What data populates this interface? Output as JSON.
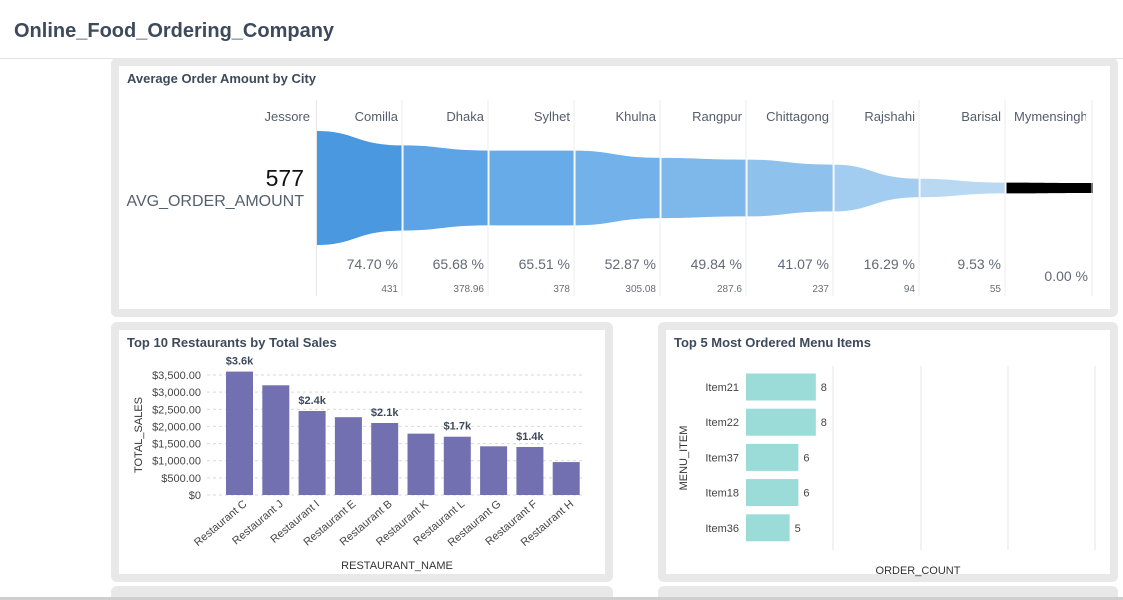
{
  "page": {
    "title": "Online_Food_Ordering_Company"
  },
  "funnel_tile": {
    "title": "Average Order Amount by City",
    "kpi_value": "577",
    "kpi_label": "AVG_ORDER_AMOUNT"
  },
  "bar_tile": {
    "title": "Top 10 Restaurants by Total Sales"
  },
  "hbar_tile": {
    "title": "Top 5 Most Ordered Menu Items"
  },
  "colors": {
    "funnel": [
      "#4a98e0",
      "#5da4e6",
      "#67abe8",
      "#72b1e9",
      "#7eb8eb",
      "#8fc1ed",
      "#a3cdf0",
      "#b9d9f3"
    ],
    "bar": "#7370b1",
    "hbar": "#9bdbd8"
  },
  "chart_data": [
    {
      "type": "funnel",
      "title": "Average Order Amount by City",
      "categories": [
        "Jessore",
        "Comilla",
        "Dhaka",
        "Sylhet",
        "Khulna",
        "Rangpur",
        "Chittagong",
        "Rajshahi",
        "Barisal",
        "Mymensingh"
      ],
      "category_labels": [
        "Jessore",
        "Comilla",
        "Dhaka",
        "Sylhet",
        "Khulna",
        "Rangpur",
        "Chittagong",
        "Rajshahi",
        "Barisal",
        "Mymensingh"
      ],
      "values": [
        577,
        431,
        378.96,
        378,
        305.08,
        287.6,
        237,
        94,
        55,
        0
      ],
      "percent_labels": [
        "74.70 %",
        "65.68 %",
        "65.51 %",
        "52.87 %",
        "49.84 %",
        "41.07 %",
        "16.29 %",
        "9.53 %",
        "0.00 %"
      ],
      "value_labels": [
        "431",
        "378.96",
        "378",
        "305.08",
        "287.6",
        "237",
        "94",
        "55"
      ]
    },
    {
      "type": "bar",
      "title": "Top 10 Restaurants by Total Sales",
      "xlabel": "RESTAURANT_NAME",
      "ylabel": "TOTAL_SALES",
      "categories": [
        "Restaurant C",
        "Restaurant J",
        "Restaurant I",
        "Restaurant E",
        "Restaurant B",
        "Restaurant K",
        "Restaurant L",
        "Restaurant G",
        "Restaurant F",
        "Restaurant H"
      ],
      "values": [
        3600,
        3200,
        2450,
        2270,
        2100,
        1790,
        1700,
        1420,
        1400,
        960
      ],
      "data_labels": [
        "$3.6k",
        "",
        "$2.4k",
        "",
        "$2.1k",
        "",
        "$1.7k",
        "",
        "$1.4k",
        ""
      ],
      "ylim": [
        0,
        3500
      ],
      "yticks": [
        0,
        500,
        1000,
        1500,
        2000,
        2500,
        3000,
        3500
      ],
      "ytick_labels": [
        "$0",
        "$500.00",
        "$1,000.00",
        "$1,500.00",
        "$2,000.00",
        "$2,500.00",
        "$3,000.00",
        "$3,500.00"
      ],
      "grid": true
    },
    {
      "type": "bar",
      "orientation": "horizontal",
      "title": "Top 5 Most Ordered Menu Items",
      "xlabel": "ORDER_COUNT",
      "ylabel": "MENU_ITEM",
      "categories": [
        "Item21",
        "Item22",
        "Item37",
        "Item18",
        "Item36"
      ],
      "values": [
        8,
        8,
        6,
        6,
        5
      ],
      "data_labels": [
        "8",
        "8",
        "6",
        "6",
        "5"
      ],
      "xlim": [
        0,
        40
      ],
      "grid": true
    }
  ]
}
